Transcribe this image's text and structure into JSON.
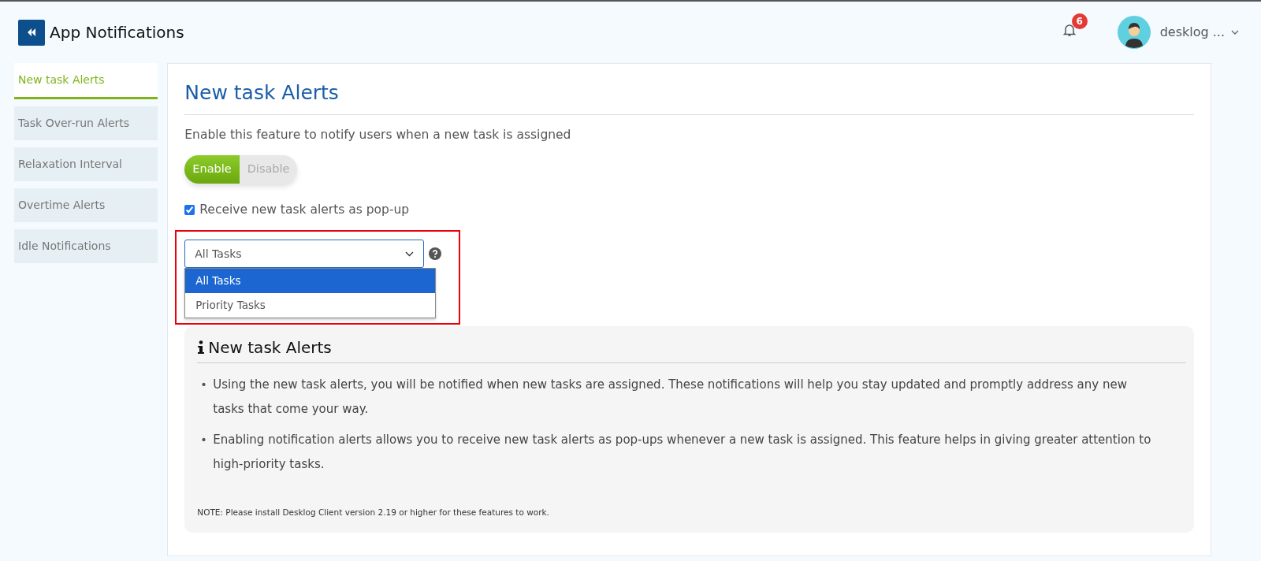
{
  "header": {
    "title": "App Notifications",
    "notification_count": "6",
    "user_name": "desklog ..."
  },
  "sidebar": {
    "items": [
      {
        "label": "New task Alerts",
        "selected": true
      },
      {
        "label": "Task Over-run Alerts",
        "selected": false
      },
      {
        "label": "Relaxation Interval",
        "selected": false
      },
      {
        "label": "Overtime Alerts",
        "selected": false
      },
      {
        "label": "Idle Notifications",
        "selected": false
      }
    ]
  },
  "panel": {
    "title": "New task Alerts",
    "description": "Enable this feature to notify users when a new task is assigned",
    "toggle": [
      {
        "label": "Enable",
        "selected": true
      },
      {
        "label": "Disable",
        "selected": false
      }
    ],
    "checkbox": {
      "label": "Receive new task alerts as pop-up",
      "checked": true
    },
    "select": {
      "value": "All Tasks",
      "expanded": true,
      "highlighted": true,
      "options": [
        {
          "label": "All Tasks",
          "selected": true
        },
        {
          "label": "Priority Tasks",
          "selected": false
        }
      ]
    },
    "info": {
      "title": "New task Alerts",
      "bullets": [
        {
          "marker": "•",
          "text": "Using the new task alerts, you will be notified when new tasks are assigned. These notifications will help you stay updated and promptly address any new tasks that come your way."
        },
        {
          "marker": "•",
          "text": "Enabling notification alerts allows you to receive new task alerts as pop-ups whenever a new task is assigned. This feature helps in giving greater attention to high-priority tasks."
        }
      ],
      "note": "NOTE: Please install Desklog Client version 2.19 or higher for these features to work."
    }
  }
}
